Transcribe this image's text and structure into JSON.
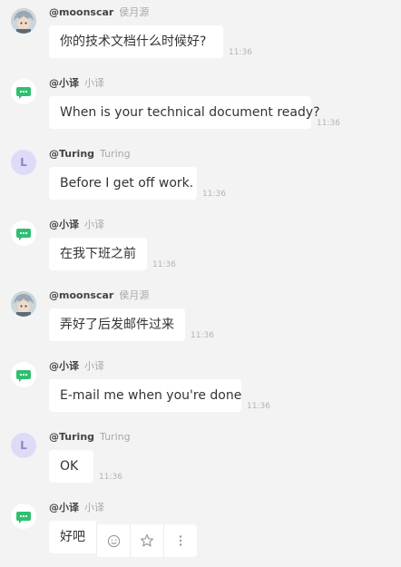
{
  "messages": [
    {
      "handle": "@moonscar",
      "name": "侯月源",
      "text": "你的技术文档什么时候好?",
      "time": "11:36",
      "avatar": "photo"
    },
    {
      "handle": "@小译",
      "name": "小译",
      "text": "When is your technical document ready?",
      "time": "11:36",
      "avatar": "bot"
    },
    {
      "handle": "@Turing",
      "name": "Turing",
      "text": "Before I get off work.",
      "time": "11:36",
      "avatar": "letter",
      "avatar_letter": "L"
    },
    {
      "handle": "@小译",
      "name": "小译",
      "text": "在我下班之前",
      "time": "11:36",
      "avatar": "bot"
    },
    {
      "handle": "@moonscar",
      "name": "侯月源",
      "text": "弄好了后发邮件过来",
      "time": "11:36",
      "avatar": "photo"
    },
    {
      "handle": "@小译",
      "name": "小译",
      "text": "E-mail me when you're done",
      "time": "11:36",
      "avatar": "bot"
    },
    {
      "handle": "@Turing",
      "name": "Turing",
      "text": "OK",
      "time": "11:36",
      "avatar": "letter",
      "avatar_letter": "L"
    },
    {
      "handle": "@小译",
      "name": "小译",
      "text": "好吧",
      "time": "",
      "avatar": "bot"
    }
  ],
  "hover_actions": [
    "emoji-reaction-icon",
    "star-icon",
    "more-vertical-icon"
  ],
  "colors": {
    "background": "#f3f3f3",
    "bubble": "#ffffff",
    "bot_green": "#2fbf71",
    "letter_avatar_bg": "#dedbf7",
    "letter_avatar_fg": "#8a86c9"
  }
}
